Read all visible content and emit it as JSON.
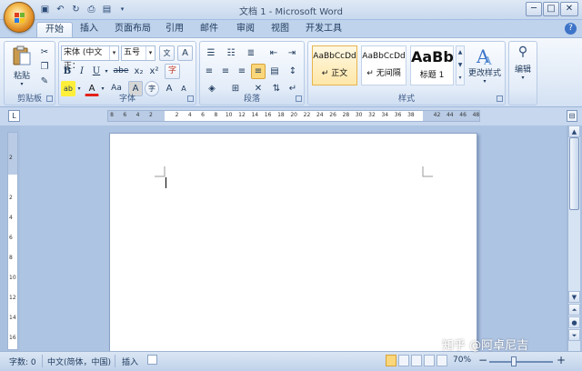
{
  "window": {
    "title": "文档 1 - Microsoft Word"
  },
  "quick_access": {
    "save_icon": "save-icon",
    "undo_icon": "undo-icon",
    "redo_icon": "redo-icon",
    "preview_icon": "print-preview-icon",
    "print_icon": "print-icon",
    "customize_icon": "customize-dropdown-icon"
  },
  "window_buttons": {
    "minimize": "─",
    "maximize": "□",
    "close": "✕"
  },
  "tabs": [
    "开始",
    "插入",
    "页面布局",
    "引用",
    "邮件",
    "审阅",
    "视图",
    "开发工具"
  ],
  "active_tab": "开始",
  "help": "?",
  "ribbon": {
    "clipboard": {
      "label": "剪贴板",
      "paste": "粘贴"
    },
    "font": {
      "label": "字体",
      "font_name": "宋体 (中文正：",
      "font_size": "五号",
      "bold": "B",
      "italic": "I",
      "underline": "U",
      "strike": "abe",
      "subscript": "x₂",
      "superscript": "x²",
      "clear_format": "A",
      "grow_font": "A",
      "shrink_font": "A",
      "case": "Aa",
      "char_border": "A",
      "highlight": "ab",
      "font_color": "A",
      "char_shading": "A",
      "enclose": "字",
      "phonetic": "文"
    },
    "paragraph": {
      "label": "段落"
    },
    "styles": {
      "label": "样式",
      "items": [
        {
          "sample": "AaBbCcDd",
          "name": "↵ 正文"
        },
        {
          "sample": "AaBbCcDd",
          "name": "↵ 无间隔"
        },
        {
          "sample": "AaBb",
          "name": "标题 1"
        }
      ],
      "change_styles": "更改样式"
    },
    "editing": {
      "label": "编辑"
    }
  },
  "ruler": {
    "ticks": [
      "8",
      "6",
      "4",
      "2",
      "",
      "2",
      "4",
      "6",
      "8",
      "10",
      "12",
      "14",
      "16",
      "18",
      "20",
      "22",
      "24",
      "26",
      "28",
      "30",
      "32",
      "34",
      "36",
      "38",
      "",
      "42",
      "44",
      "46",
      "48"
    ],
    "vticks": [
      "2",
      "",
      "2",
      "4",
      "6",
      "8",
      "10",
      "12",
      "14",
      "16"
    ]
  },
  "statusbar": {
    "word_count": "字数: 0",
    "language": "中文(简体，中国)",
    "mode": "插入",
    "zoom": "70%",
    "zoom_out": "−",
    "zoom_in": "+"
  },
  "watermark": "知乎 @阿卓尼吉"
}
